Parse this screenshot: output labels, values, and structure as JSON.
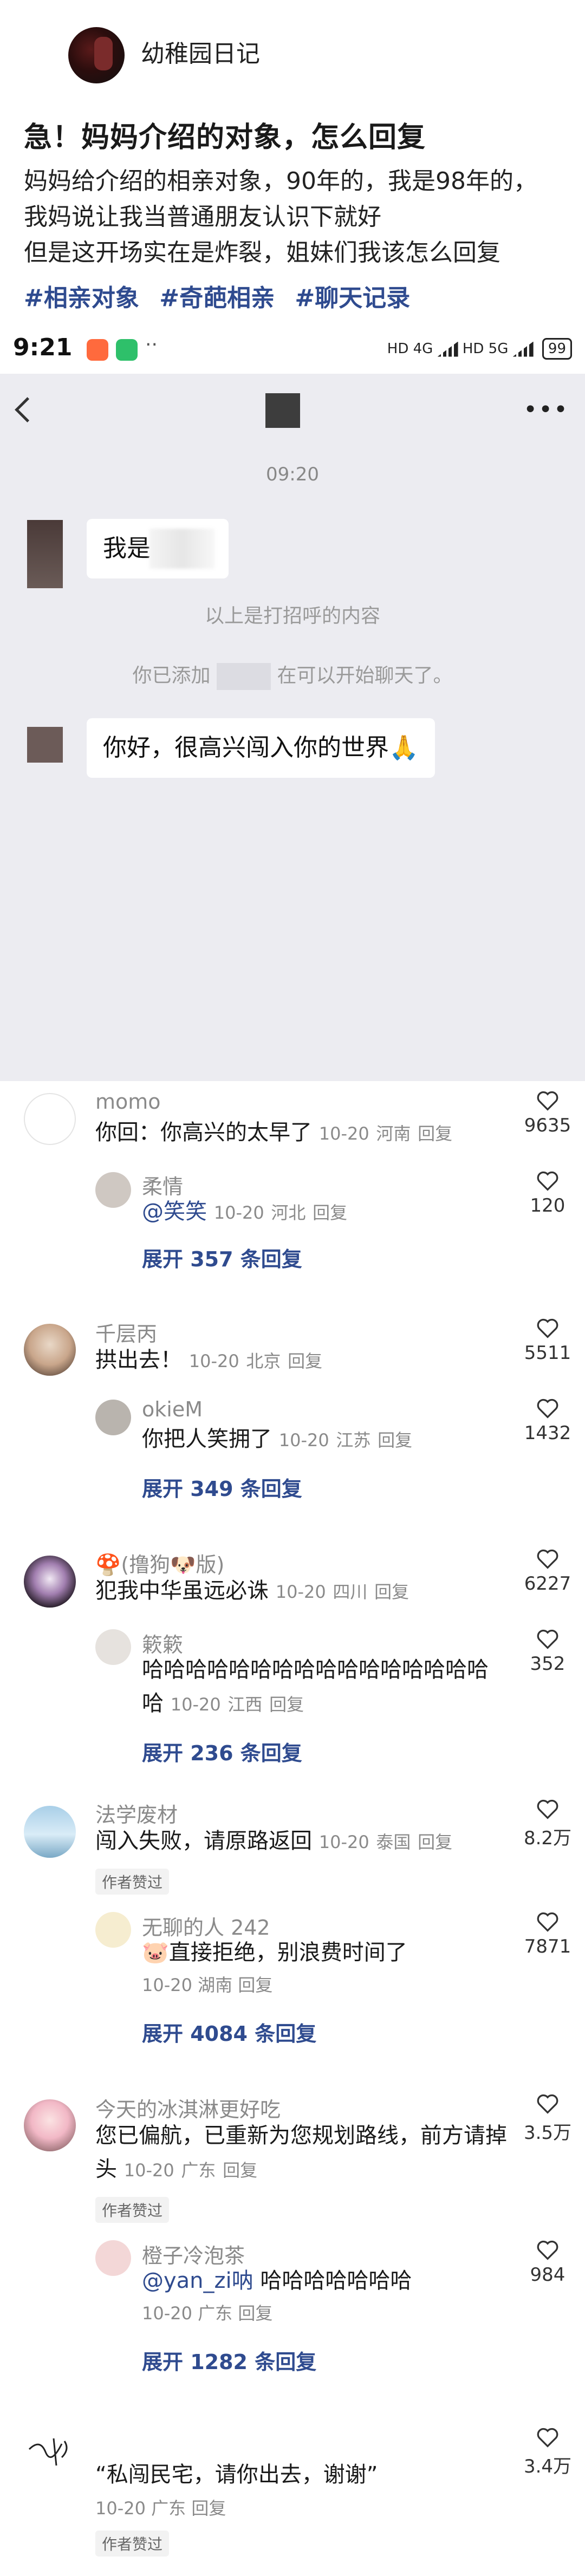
{
  "author": {
    "name": "幼稚园日记"
  },
  "post": {
    "title": "急！妈妈介绍的对象，怎么回复",
    "body": [
      "妈妈给介绍的相亲对象，90年的，我是98年的，",
      "我妈说让我当普通朋友认识下就好",
      "但是这开场实在是炸裂，姐妹们我该怎么回复"
    ],
    "tags": [
      "#相亲对象",
      "#奇葩相亲",
      "#聊天记录"
    ]
  },
  "phone": {
    "status_time": "9:21",
    "status_dots": "··",
    "status_signal_1": "HD 4G",
    "status_signal_2": "HD 5G",
    "battery": "99",
    "chat_time": "09:20",
    "msg1_text": "我是",
    "note1": "以上是打招呼的内容",
    "note2_left": "你已添加",
    "note2_right": "在可以开始聊天了。",
    "msg2_text": "你好，很高兴闯入你的世界🙏"
  },
  "comments": [
    {
      "name": "momo",
      "text": "你回：你高兴的太早了",
      "date": "10-20",
      "region": "河南",
      "reply": "回复",
      "likes": "9635",
      "reply_item": {
        "name": "柔情",
        "mention": "@笑笑",
        "date": "10-20",
        "region": "河北",
        "reply": "回复",
        "likes": "120"
      },
      "expand": "展开 357 条回复"
    },
    {
      "name": "千层丙",
      "text": "拱出去！",
      "date": "10-20",
      "region": "北京",
      "reply": "回复",
      "likes": "5511",
      "reply_item": {
        "name": "okieM",
        "text": "你把人笑拥了",
        "date": "10-20",
        "region": "江苏",
        "reply": "回复",
        "likes": "1432"
      },
      "expand": "展开 349 条回复"
    },
    {
      "name": "🍄(撸狗🐶版)",
      "text": "犯我中华虽远必诛",
      "date": "10-20",
      "region": "四川",
      "reply": "回复",
      "likes": "6227",
      "reply_item": {
        "name": "簌簌",
        "text_line1": "哈哈哈哈哈哈哈哈哈哈哈哈哈哈哈哈",
        "text_line2": "哈",
        "date": "10-20",
        "region": "江西",
        "reply": "回复",
        "likes": "352"
      },
      "expand": "展开 236 条回复"
    },
    {
      "name": "法学废材",
      "text": "闯入失败，请原路返回",
      "date": "10-20",
      "region": "泰国",
      "reply": "回复",
      "likes": "8.2万",
      "author_liked": "作者赞过",
      "reply_item": {
        "name": "无聊的人 242",
        "text": "🐷直接拒绝，别浪费时间了",
        "date": "10-20",
        "region": "湖南",
        "reply": "回复",
        "likes": "7871"
      },
      "expand": "展开 4084 条回复"
    },
    {
      "name": "今天的冰淇淋更好吃",
      "text_line1": "您已偏航，已重新为您规划路线，前方请掉",
      "text_line2": "头",
      "date": "10-20",
      "region": "广东",
      "reply": "回复",
      "likes": "3.5万",
      "author_liked": "作者赞过",
      "reply_item": {
        "name": "橙子冷泡茶",
        "mention": "@yan_zi呐",
        "text": "哈哈哈哈哈哈哈",
        "date": "10-20",
        "region": "广东",
        "reply": "回复",
        "likes": "984"
      },
      "expand": "展开 1282 条回复"
    },
    {
      "name": "",
      "text": "“私闯民宅，请你出去，谢谢”",
      "date": "10-20",
      "region": "广东",
      "reply": "回复",
      "likes": "3.4万",
      "author_liked": "作者赞过"
    }
  ],
  "colors": {
    "link": "#2f4b8f",
    "meta": "#8a8a8a",
    "chat_bg": "#ececf1"
  }
}
